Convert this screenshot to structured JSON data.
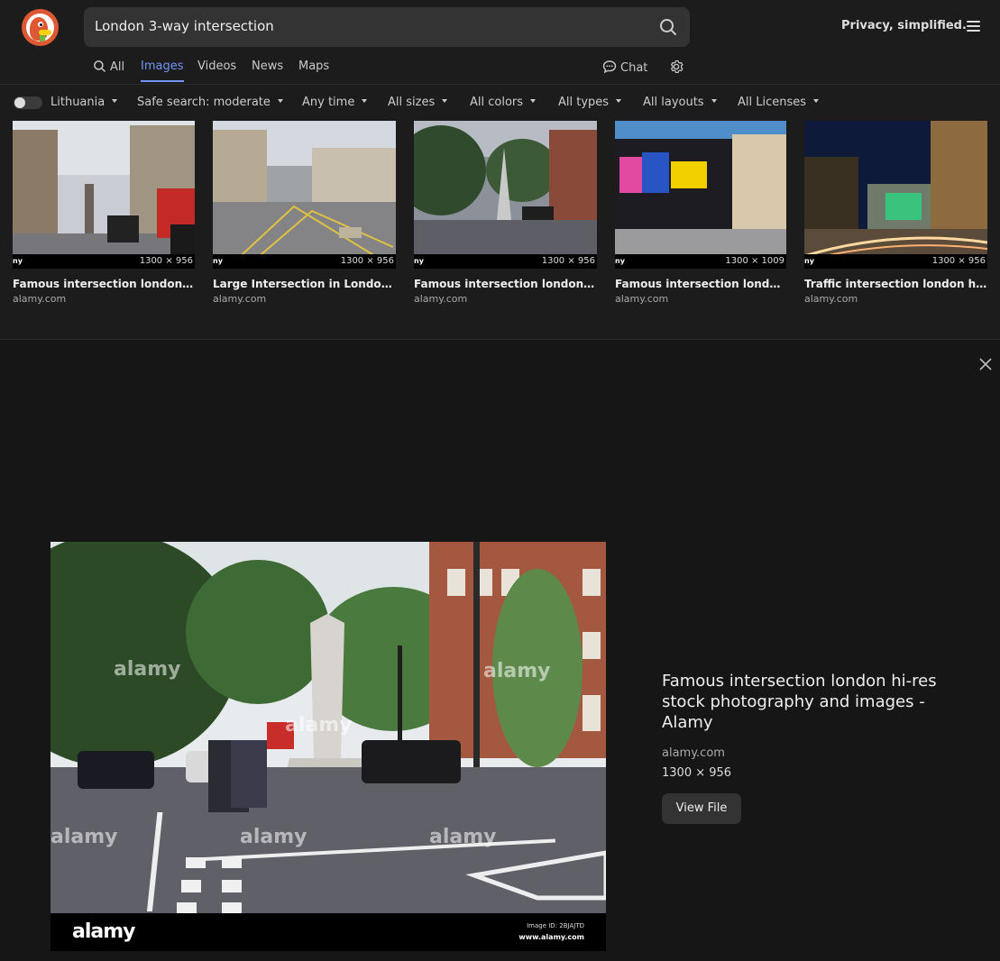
{
  "header": {
    "search_query": "London 3-way intersection",
    "tagline": "Privacy, simplified."
  },
  "tabs": [
    {
      "label": "All"
    },
    {
      "label": "Images"
    },
    {
      "label": "Videos"
    },
    {
      "label": "News"
    },
    {
      "label": "Maps"
    }
  ],
  "chat_label": "Chat",
  "filters": [
    {
      "label": "Lithuania"
    },
    {
      "label": "Safe search: moderate"
    },
    {
      "label": "Any time"
    },
    {
      "label": "All sizes"
    },
    {
      "label": "All colors"
    },
    {
      "label": "All types"
    },
    {
      "label": "All layouts"
    },
    {
      "label": "All Licenses"
    }
  ],
  "results": [
    {
      "title": "Famous intersection london hi-res stock photography and images - Alamy",
      "domain": "alamy.com",
      "dims": "1300 × 956"
    },
    {
      "title": "Large Intersection in London England Stock Photo - Alamy",
      "domain": "alamy.com",
      "dims": "1300 × 956"
    },
    {
      "title": "Famous intersection london hi-res stock photography and images - Alamy",
      "domain": "alamy.com",
      "dims": "1300 × 956"
    },
    {
      "title": "Famous intersection london hi-res stock photography and images - Alamy",
      "domain": "alamy.com",
      "dims": "1300 × 1009"
    },
    {
      "title": "Traffic intersection london hi-res stock photography and images - Alamy",
      "domain": "alamy.com",
      "dims": "1300 × 956"
    }
  ],
  "detail": {
    "title": "Famous intersection london hi-res stock photography and images - Alamy",
    "domain": "alamy.com",
    "dims": "1300 × 956",
    "view_button": "View File",
    "image_brand": "alamy",
    "image_id": "Image ID: 2BJAJTD",
    "image_url": "www.alamy.com"
  }
}
